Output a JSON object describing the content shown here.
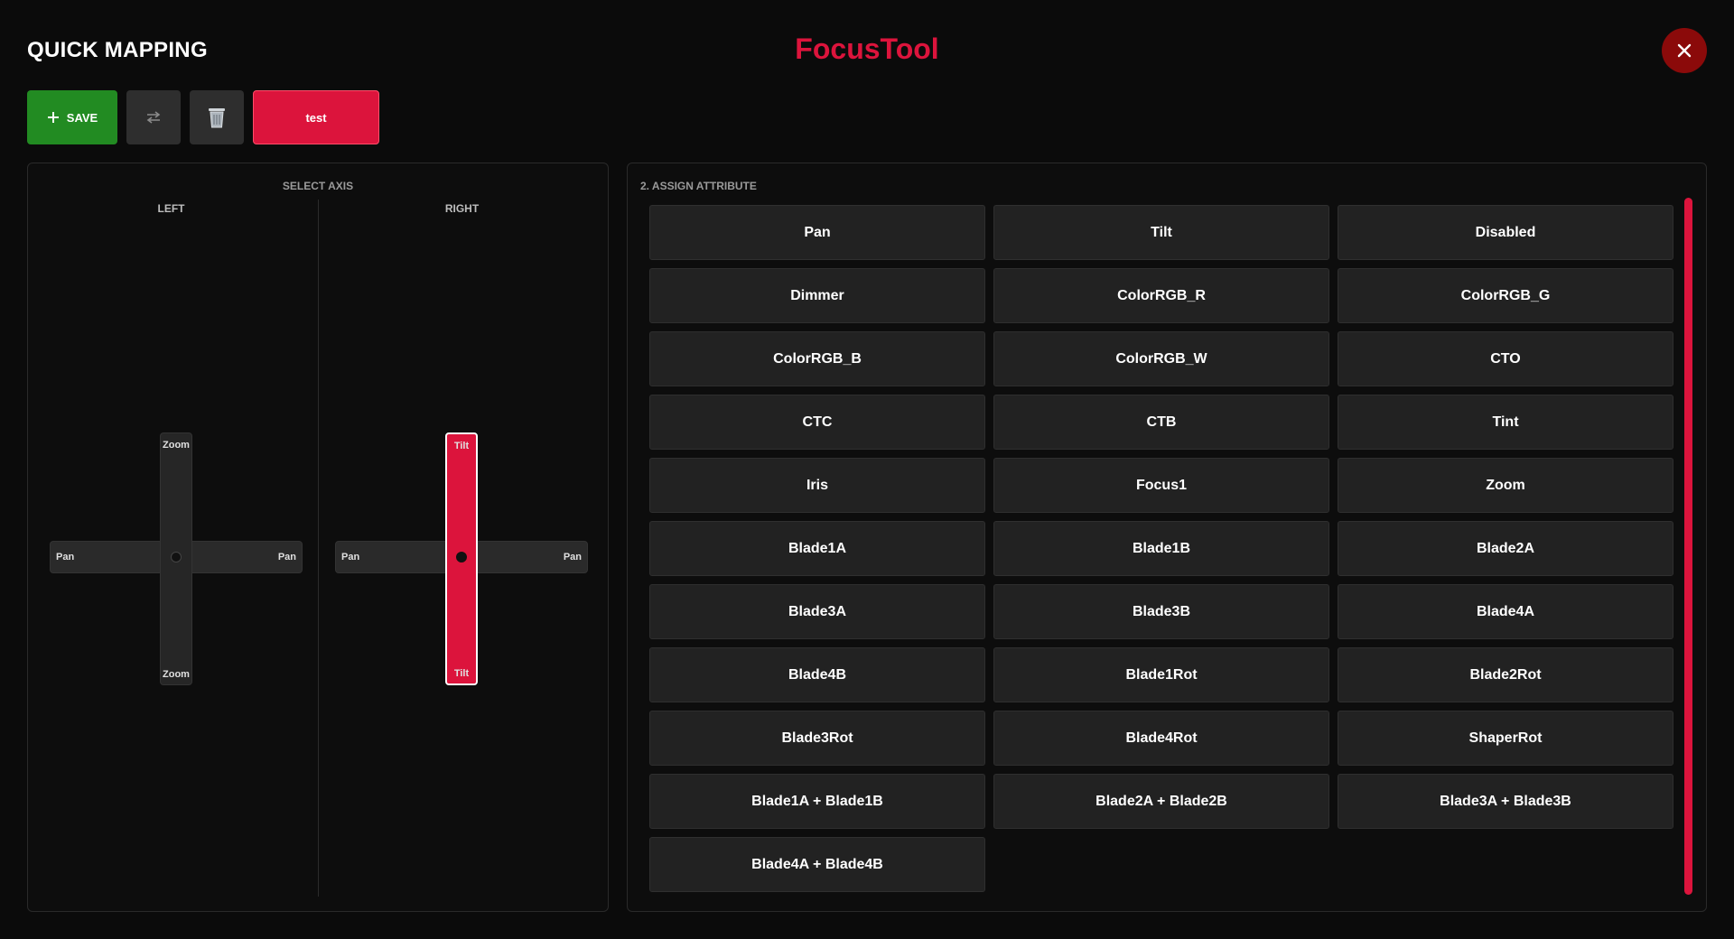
{
  "header": {
    "title": "QUICK MAPPING",
    "brand": "FocusTool",
    "close_icon": "close-icon"
  },
  "toolbar": {
    "save_label": "SAVE",
    "swap_icon": "swap-arrows-icon",
    "trash_icon": "trash-icon",
    "profile_label": "test"
  },
  "axis_panel": {
    "caption": "SELECT AXIS",
    "left": {
      "label": "LEFT",
      "h_left": "Pan",
      "h_right": "Pan",
      "v_top": "Zoom",
      "v_bottom": "Zoom",
      "active": false
    },
    "right": {
      "label": "RIGHT",
      "h_left": "Pan",
      "h_right": "Pan",
      "v_top": "Tilt",
      "v_bottom": "Tilt",
      "active": true
    }
  },
  "attribute_panel": {
    "caption": "2. ASSIGN ATTRIBUTE",
    "attributes": [
      "Pan",
      "Tilt",
      "Disabled",
      "Dimmer",
      "ColorRGB_R",
      "ColorRGB_G",
      "ColorRGB_B",
      "ColorRGB_W",
      "CTO",
      "CTC",
      "CTB",
      "Tint",
      "Iris",
      "Focus1",
      "Zoom",
      "Blade1A",
      "Blade1B",
      "Blade2A",
      "Blade3A",
      "Blade3B",
      "Blade4A",
      "Blade4B",
      "Blade1Rot",
      "Blade2Rot",
      "Blade3Rot",
      "Blade4Rot",
      "ShaperRot",
      "Blade1A + Blade1B",
      "Blade2A + Blade2B",
      "Blade3A + Blade3B",
      "Blade4A + Blade4B"
    ]
  },
  "colors": {
    "accent": "#dc143c",
    "save": "#228b22",
    "close": "#8b0a0a",
    "background": "#0b0b0b"
  }
}
